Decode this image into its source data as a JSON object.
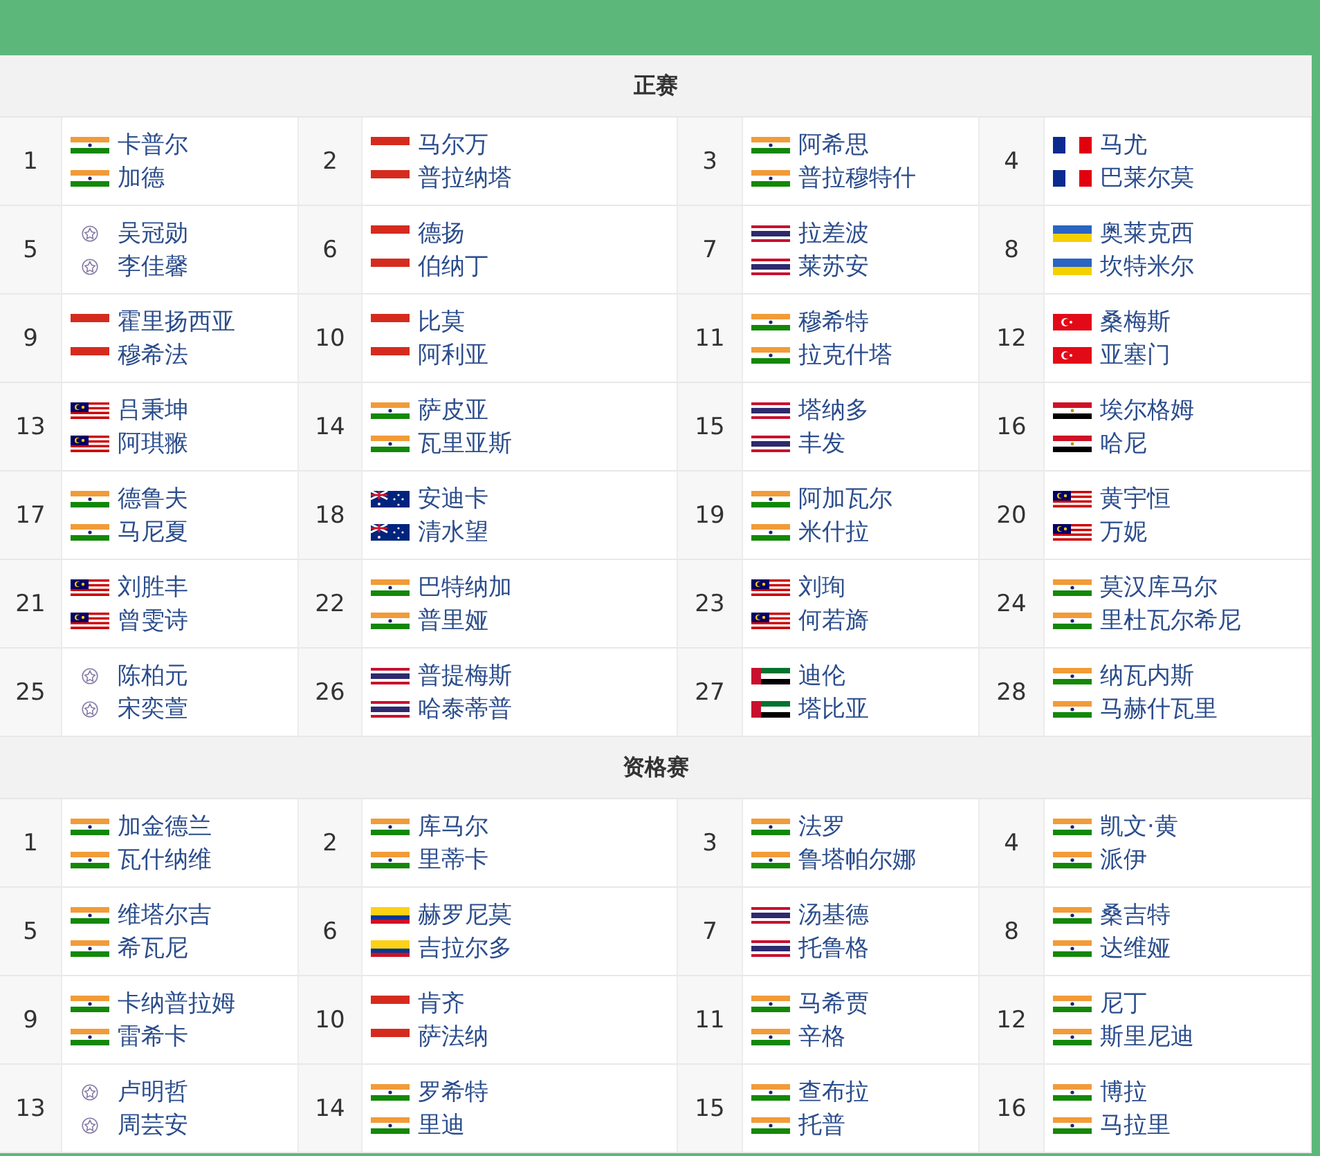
{
  "sections": [
    {
      "title": "正赛",
      "seeds": [
        {
          "seed": "1",
          "players": [
            {
              "name": "卡普尔",
              "kind": "ind"
            },
            {
              "name": "加德",
              "kind": "ind"
            }
          ]
        },
        {
          "seed": "2",
          "players": [
            {
              "name": "马尔万",
              "kind": "ina"
            },
            {
              "name": "普拉纳塔",
              "kind": "ina"
            }
          ]
        },
        {
          "seed": "3",
          "players": [
            {
              "name": "阿希思",
              "kind": "ind"
            },
            {
              "name": "普拉穆特什",
              "kind": "ind"
            }
          ]
        },
        {
          "seed": "4",
          "players": [
            {
              "name": "马尤",
              "kind": "fra"
            },
            {
              "name": "巴莱尔莫",
              "kind": "fra"
            }
          ]
        },
        {
          "seed": "5",
          "players": [
            {
              "name": "吴冠勋",
              "kind": "tpe"
            },
            {
              "name": "李佳馨",
              "kind": "tpe"
            }
          ]
        },
        {
          "seed": "6",
          "players": [
            {
              "name": "德扬",
              "kind": "ina"
            },
            {
              "name": "伯纳丁",
              "kind": "ina"
            }
          ]
        },
        {
          "seed": "7",
          "players": [
            {
              "name": "拉差波",
              "kind": "tha"
            },
            {
              "name": "莱苏安",
              "kind": "tha"
            }
          ]
        },
        {
          "seed": "8",
          "players": [
            {
              "name": "奥莱克西",
              "kind": "ukr"
            },
            {
              "name": "坎特米尔",
              "kind": "ukr"
            }
          ]
        },
        {
          "seed": "9",
          "players": [
            {
              "name": "霍里扬西亚",
              "kind": "ina"
            },
            {
              "name": "穆希法",
              "kind": "ina"
            }
          ]
        },
        {
          "seed": "10",
          "players": [
            {
              "name": "比莫",
              "kind": "ina"
            },
            {
              "name": "阿利亚",
              "kind": "ina"
            }
          ]
        },
        {
          "seed": "11",
          "players": [
            {
              "name": "穆希特",
              "kind": "ind"
            },
            {
              "name": "拉克什塔",
              "kind": "ind"
            }
          ]
        },
        {
          "seed": "12",
          "players": [
            {
              "name": "桑梅斯",
              "kind": "tur"
            },
            {
              "name": "亚塞门",
              "kind": "tur"
            }
          ]
        },
        {
          "seed": "13",
          "players": [
            {
              "name": "吕秉坤",
              "kind": "mas"
            },
            {
              "name": "阿琪翭",
              "kind": "mas"
            }
          ]
        },
        {
          "seed": "14",
          "players": [
            {
              "name": "萨皮亚",
              "kind": "ind"
            },
            {
              "name": "瓦里亚斯",
              "kind": "ind"
            }
          ]
        },
        {
          "seed": "15",
          "players": [
            {
              "name": "塔纳多",
              "kind": "tha"
            },
            {
              "name": "丰发",
              "kind": "tha"
            }
          ]
        },
        {
          "seed": "16",
          "players": [
            {
              "name": "埃尔格姆",
              "kind": "egy"
            },
            {
              "name": "哈尼",
              "kind": "egy"
            }
          ]
        },
        {
          "seed": "17",
          "players": [
            {
              "name": "德鲁夫",
              "kind": "ind"
            },
            {
              "name": "马尼夏",
              "kind": "ind"
            }
          ]
        },
        {
          "seed": "18",
          "players": [
            {
              "name": "安迪卡",
              "kind": "aus"
            },
            {
              "name": "清水望",
              "kind": "aus"
            }
          ]
        },
        {
          "seed": "19",
          "players": [
            {
              "name": "阿加瓦尔",
              "kind": "ind"
            },
            {
              "name": "米什拉",
              "kind": "ind"
            }
          ]
        },
        {
          "seed": "20",
          "players": [
            {
              "name": "黄宇恒",
              "kind": "mas"
            },
            {
              "name": "万妮",
              "kind": "mas"
            }
          ]
        },
        {
          "seed": "21",
          "players": [
            {
              "name": "刘胜丰",
              "kind": "mas"
            },
            {
              "name": "曾雯诗",
              "kind": "mas"
            }
          ]
        },
        {
          "seed": "22",
          "players": [
            {
              "name": "巴特纳加",
              "kind": "ind"
            },
            {
              "name": "普里娅",
              "kind": "ind"
            }
          ]
        },
        {
          "seed": "23",
          "players": [
            {
              "name": "刘珣",
              "kind": "mas"
            },
            {
              "name": "何若旖",
              "kind": "mas"
            }
          ]
        },
        {
          "seed": "24",
          "players": [
            {
              "name": "莫汉库马尔",
              "kind": "ind"
            },
            {
              "name": "里杜瓦尔希尼",
              "kind": "ind"
            }
          ]
        },
        {
          "seed": "25",
          "players": [
            {
              "name": "陈柏元",
              "kind": "tpe"
            },
            {
              "name": "宋奕萱",
              "kind": "tpe"
            }
          ]
        },
        {
          "seed": "26",
          "players": [
            {
              "name": "普提梅斯",
              "kind": "tha"
            },
            {
              "name": "哈泰蒂普",
              "kind": "tha"
            }
          ]
        },
        {
          "seed": "27",
          "players": [
            {
              "name": "迪伦",
              "kind": "uae"
            },
            {
              "name": "塔比亚",
              "kind": "uae"
            }
          ]
        },
        {
          "seed": "28",
          "players": [
            {
              "name": "纳瓦内斯",
              "kind": "ind"
            },
            {
              "name": "马赫什瓦里",
              "kind": "ind"
            }
          ]
        }
      ]
    },
    {
      "title": "资格赛",
      "seeds": [
        {
          "seed": "1",
          "players": [
            {
              "name": "加金德兰",
              "kind": "ind"
            },
            {
              "name": "瓦什纳维",
              "kind": "ind"
            }
          ]
        },
        {
          "seed": "2",
          "players": [
            {
              "name": "库马尔",
              "kind": "ind"
            },
            {
              "name": "里蒂卡",
              "kind": "ind"
            }
          ]
        },
        {
          "seed": "3",
          "players": [
            {
              "name": "法罗",
              "kind": "ind"
            },
            {
              "name": "鲁塔帕尔娜",
              "kind": "ind"
            }
          ]
        },
        {
          "seed": "4",
          "players": [
            {
              "name": "凯文·黄",
              "kind": "ind"
            },
            {
              "name": "派伊",
              "kind": "ind"
            }
          ]
        },
        {
          "seed": "5",
          "players": [
            {
              "name": "维塔尔吉",
              "kind": "ind"
            },
            {
              "name": "希瓦尼",
              "kind": "ind"
            }
          ]
        },
        {
          "seed": "6",
          "players": [
            {
              "name": "赫罗尼莫",
              "kind": "col"
            },
            {
              "name": "吉拉尔多",
              "kind": "col"
            }
          ]
        },
        {
          "seed": "7",
          "players": [
            {
              "name": "汤基德",
              "kind": "tha"
            },
            {
              "name": "托鲁格",
              "kind": "tha"
            }
          ]
        },
        {
          "seed": "8",
          "players": [
            {
              "name": "桑吉特",
              "kind": "ind"
            },
            {
              "name": "达维娅",
              "kind": "ind"
            }
          ]
        },
        {
          "seed": "9",
          "players": [
            {
              "name": "卡纳普拉姆",
              "kind": "ind"
            },
            {
              "name": "雷希卡",
              "kind": "ind"
            }
          ]
        },
        {
          "seed": "10",
          "players": [
            {
              "name": "肯齐",
              "kind": "ina"
            },
            {
              "name": "萨法纳",
              "kind": "ina"
            }
          ]
        },
        {
          "seed": "11",
          "players": [
            {
              "name": "马希贾",
              "kind": "ind"
            },
            {
              "name": "辛格",
              "kind": "ind"
            }
          ]
        },
        {
          "seed": "12",
          "players": [
            {
              "name": "尼丁",
              "kind": "ind"
            },
            {
              "name": "斯里尼迪",
              "kind": "ind"
            }
          ]
        },
        {
          "seed": "13",
          "players": [
            {
              "name": "卢明哲",
              "kind": "tpe"
            },
            {
              "name": "周芸安",
              "kind": "tpe"
            }
          ]
        },
        {
          "seed": "14",
          "players": [
            {
              "name": "罗希特",
              "kind": "ind"
            },
            {
              "name": "里迪",
              "kind": "ind"
            }
          ]
        },
        {
          "seed": "15",
          "players": [
            {
              "name": "查布拉",
              "kind": "ind"
            },
            {
              "name": "托普",
              "kind": "ind"
            }
          ]
        },
        {
          "seed": "16",
          "players": [
            {
              "name": "博拉",
              "kind": "ind"
            },
            {
              "name": "马拉里",
              "kind": "ind"
            }
          ]
        }
      ]
    }
  ]
}
